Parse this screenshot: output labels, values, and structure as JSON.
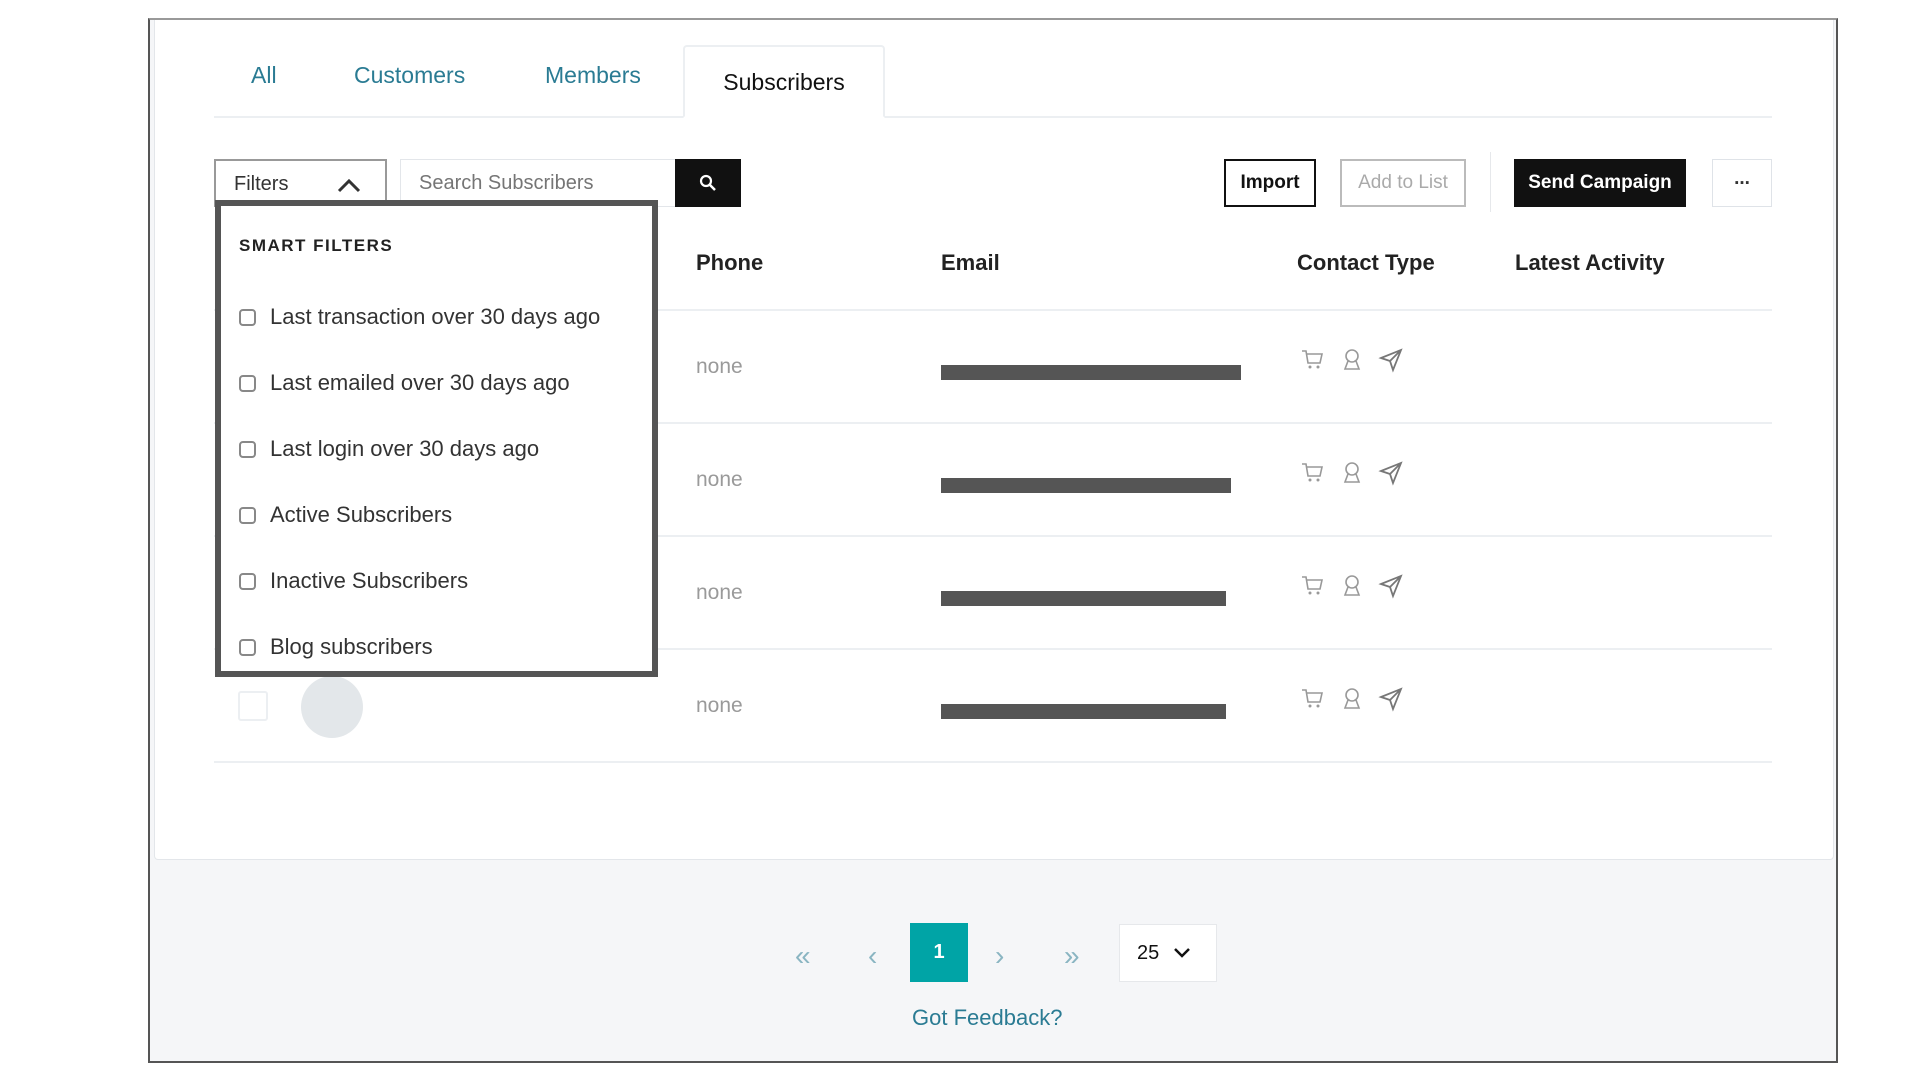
{
  "tabs": [
    {
      "label": "All"
    },
    {
      "label": "Customers"
    },
    {
      "label": "Members"
    },
    {
      "label": "Subscribers",
      "active": true
    }
  ],
  "toolbar": {
    "filters_label": "Filters",
    "search_placeholder": "Search Subscribers",
    "import_label": "Import",
    "add_to_list_label": "Add to List",
    "send_campaign_label": "Send Campaign",
    "more_label": "..."
  },
  "table": {
    "headers": [
      "Phone",
      "Email",
      "Contact Type",
      "Latest Activity"
    ],
    "rows": [
      {
        "phone": "none",
        "email": "[redacted]"
      },
      {
        "phone": "none",
        "email": "[redacted]"
      },
      {
        "phone": "none",
        "email": "[redacted]"
      },
      {
        "phone": "none",
        "email": "[redacted]"
      }
    ],
    "contact_type_icons": [
      "cart-icon",
      "user-icon",
      "send-icon"
    ]
  },
  "smart_filters": {
    "title": "SMART FILTERS",
    "options": [
      "Last transaction over 30 days ago",
      "Last emailed over 30 days ago",
      "Last login over 30 days ago",
      "Active Subscribers",
      "Inactive Subscribers",
      "Blog subscribers"
    ]
  },
  "pagination": {
    "first": "«",
    "prev": "‹",
    "current": "1",
    "next": "›",
    "last": "»",
    "page_size": "25"
  },
  "feedback_label": "Got Feedback?",
  "colors": {
    "accent": "#00a4a6",
    "tab_link": "#2a7b93",
    "primary_button": "#111111"
  }
}
